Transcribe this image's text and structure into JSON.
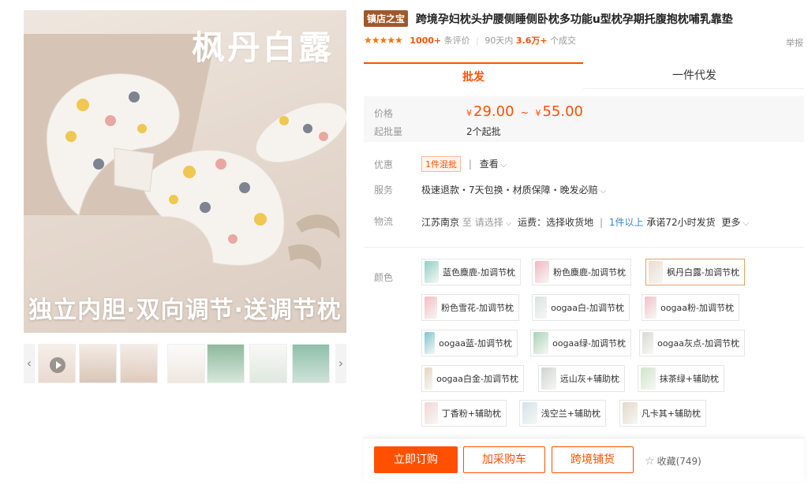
{
  "gallery": {
    "brand_title": "枫丹白露",
    "slogan": "独立内胆·双向调节·送调节枕",
    "prev_icon": "chevron-left-icon",
    "next_icon": "chevron-right-icon",
    "thumb_count": 7
  },
  "product": {
    "badge": "镇店之宝",
    "title": "跨境孕妇枕头护腰侧睡侧卧枕多功能u型枕孕期托腹抱枕哺乳靠垫",
    "rating_stars": "★★★★★",
    "reviews_count": "1000+",
    "reviews_label": "条评价",
    "sales_period": "90天内",
    "sales_count": "3.6万+",
    "sales_label": "个成交",
    "report": "举报"
  },
  "tabs": {
    "wholesale": "批发",
    "dropship": "一件代发"
  },
  "price": {
    "price_label": "价格",
    "currency": "¥",
    "min": "29.00",
    "tilde": "~",
    "max": "55.00",
    "moq_label": "起批量",
    "moq_value": "2个起批"
  },
  "info": {
    "promo_label": "优惠",
    "promo_tag": "1件混批",
    "promo_view": "查看",
    "service_label": "服务",
    "service_value": "极速退款・7天包换・材质保障・晚发必赔",
    "logistics_label": "物流",
    "logistics_origin": "江苏南京",
    "logistics_to": "至",
    "logistics_select": "请选择",
    "freight": "运费：选择收货地",
    "delivery_qty": "1件以上",
    "delivery_promise": "承诺72小时发货",
    "more": "更多"
  },
  "colors": {
    "label": "颜色",
    "options": [
      {
        "name": "蓝色麋鹿-加调节枕",
        "color": "#8fcfc4"
      },
      {
        "name": "粉色麋鹿-加调节枕",
        "color": "#f2b8c2"
      },
      {
        "name": "枫丹白露-加调节枕",
        "color": "#e8ddd2"
      },
      {
        "name": "粉色雪花-加调节枕",
        "color": "#f3bcc3"
      },
      {
        "name": "oogaa白-加调节枕",
        "color": "#d8e4e2"
      },
      {
        "name": "oogaa粉-加调节枕",
        "color": "#f1c3c6"
      },
      {
        "name": "oogaa蓝-加调节枕",
        "color": "#7fc5cf"
      },
      {
        "name": "oogaa绿-加调节枕",
        "color": "#a8d3b6"
      },
      {
        "name": "oogaa灰点-加调节枕",
        "color": "#d9d9d4"
      },
      {
        "name": "oogaa白金-加调节枕",
        "color": "#e3d5c1"
      },
      {
        "name": "远山灰+辅助枕",
        "color": "#cfd4d1"
      },
      {
        "name": "抹茶绿+辅助枕",
        "color": "#cfe4c9"
      },
      {
        "name": "丁香粉+辅助枕",
        "color": "#f0d7d5"
      },
      {
        "name": "浅空兰+辅助枕",
        "color": "#d4e2ea"
      },
      {
        "name": "凡卡其+辅助枕",
        "color": "#e2d8ca"
      }
    ]
  },
  "actions": {
    "order": "立即订购",
    "cart": "加采购车",
    "distribute": "跨境铺货",
    "favorite": "收藏(749)"
  }
}
